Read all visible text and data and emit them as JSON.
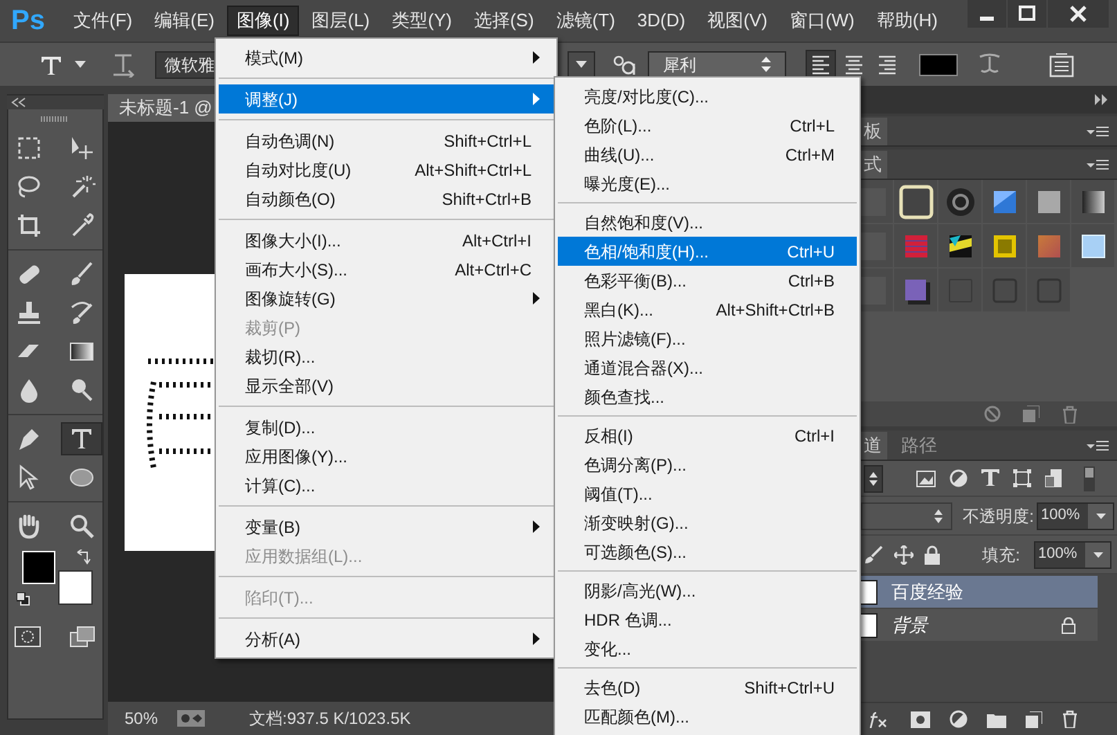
{
  "app_logo": "Ps",
  "menu_bar": [
    {
      "label": "文件(F)",
      "selected": false
    },
    {
      "label": "编辑(E)",
      "selected": false
    },
    {
      "label": "图像(I)",
      "selected": true
    },
    {
      "label": "图层(L)",
      "selected": false
    },
    {
      "label": "类型(Y)",
      "selected": false
    },
    {
      "label": "选择(S)",
      "selected": false
    },
    {
      "label": "滤镜(T)",
      "selected": false
    },
    {
      "label": "3D(D)",
      "selected": false
    },
    {
      "label": "视图(V)",
      "selected": false
    },
    {
      "label": "窗口(W)",
      "selected": false
    },
    {
      "label": "帮助(H)",
      "selected": false
    }
  ],
  "options_bar": {
    "font_family": "微软雅",
    "anti_alias": "犀利",
    "alignment": [
      {
        "selected": true
      },
      {
        "selected": false
      },
      {
        "selected": false
      }
    ]
  },
  "tools": [
    {
      "selected": false
    },
    {
      "selected": false
    },
    {
      "selected": false
    },
    {
      "selected": false
    },
    {
      "selected": false
    },
    {
      "selected": false
    },
    {
      "selected": false
    },
    {
      "selected": false
    },
    {
      "selected": false
    },
    {
      "selected": false
    },
    {
      "selected": false
    },
    {
      "selected": false
    },
    {
      "selected": false
    },
    {
      "selected": false
    },
    {
      "selected": false
    },
    {
      "selected": true
    },
    {
      "selected": false
    },
    {
      "selected": false
    },
    {
      "selected": false
    },
    {
      "selected": false
    }
  ],
  "document_tab": "未标题-1 @",
  "status_bar": {
    "zoom": "50%",
    "doc_size": "文档:937.5 K/1023.5K"
  },
  "image_menu": [
    {
      "kind": "item",
      "label": "模式(M)",
      "submenu": true,
      "selected": false,
      "disabled": false
    },
    {
      "kind": "separator"
    },
    {
      "kind": "item",
      "label": "调整(J)",
      "submenu": true,
      "selected": true,
      "disabled": false
    },
    {
      "kind": "separator"
    },
    {
      "kind": "item",
      "label": "自动色调(N)",
      "shortcut": "Shift+Ctrl+L",
      "selected": false,
      "disabled": false
    },
    {
      "kind": "item",
      "label": "自动对比度(U)",
      "shortcut": "Alt+Shift+Ctrl+L",
      "selected": false,
      "disabled": false
    },
    {
      "kind": "item",
      "label": "自动颜色(O)",
      "shortcut": "Shift+Ctrl+B",
      "selected": false,
      "disabled": false
    },
    {
      "kind": "separator"
    },
    {
      "kind": "item",
      "label": "图像大小(I)...",
      "shortcut": "Alt+Ctrl+I",
      "selected": false,
      "disabled": false
    },
    {
      "kind": "item",
      "label": "画布大小(S)...",
      "shortcut": "Alt+Ctrl+C",
      "selected": false,
      "disabled": false
    },
    {
      "kind": "item",
      "label": "图像旋转(G)",
      "submenu": true,
      "selected": false,
      "disabled": false
    },
    {
      "kind": "item",
      "label": "裁剪(P)",
      "selected": false,
      "disabled": true
    },
    {
      "kind": "item",
      "label": "裁切(R)...",
      "selected": false,
      "disabled": false
    },
    {
      "kind": "item",
      "label": "显示全部(V)",
      "selected": false,
      "disabled": false
    },
    {
      "kind": "separator"
    },
    {
      "kind": "item",
      "label": "复制(D)...",
      "selected": false,
      "disabled": false
    },
    {
      "kind": "item",
      "label": "应用图像(Y)...",
      "selected": false,
      "disabled": false
    },
    {
      "kind": "item",
      "label": "计算(C)...",
      "selected": false,
      "disabled": false
    },
    {
      "kind": "separator"
    },
    {
      "kind": "item",
      "label": "变量(B)",
      "submenu": true,
      "selected": false,
      "disabled": false
    },
    {
      "kind": "item",
      "label": "应用数据组(L)...",
      "selected": false,
      "disabled": true
    },
    {
      "kind": "separator"
    },
    {
      "kind": "item",
      "label": "陷印(T)...",
      "selected": false,
      "disabled": true
    },
    {
      "kind": "separator"
    },
    {
      "kind": "item",
      "label": "分析(A)",
      "submenu": true,
      "selected": false,
      "disabled": false
    }
  ],
  "adjustments_submenu": [
    {
      "kind": "item",
      "label": "亮度/对比度(C)...",
      "selected": false
    },
    {
      "kind": "item",
      "label": "色阶(L)...",
      "shortcut": "Ctrl+L",
      "selected": false
    },
    {
      "kind": "item",
      "label": "曲线(U)...",
      "shortcut": "Ctrl+M",
      "selected": false
    },
    {
      "kind": "item",
      "label": "曝光度(E)...",
      "selected": false
    },
    {
      "kind": "separator"
    },
    {
      "kind": "item",
      "label": "自然饱和度(V)...",
      "selected": false
    },
    {
      "kind": "item",
      "label": "色相/饱和度(H)...",
      "shortcut": "Ctrl+U",
      "selected": true
    },
    {
      "kind": "item",
      "label": "色彩平衡(B)...",
      "shortcut": "Ctrl+B",
      "selected": false
    },
    {
      "kind": "item",
      "label": "黑白(K)...",
      "shortcut": "Alt+Shift+Ctrl+B",
      "selected": false
    },
    {
      "kind": "item",
      "label": "照片滤镜(F)...",
      "selected": false
    },
    {
      "kind": "item",
      "label": "通道混合器(X)...",
      "selected": false
    },
    {
      "kind": "item",
      "label": "颜色查找...",
      "selected": false
    },
    {
      "kind": "separator"
    },
    {
      "kind": "item",
      "label": "反相(I)",
      "shortcut": "Ctrl+I",
      "selected": false
    },
    {
      "kind": "item",
      "label": "色调分离(P)...",
      "selected": false
    },
    {
      "kind": "item",
      "label": "阈值(T)...",
      "selected": false
    },
    {
      "kind": "item",
      "label": "渐变映射(G)...",
      "selected": false
    },
    {
      "kind": "item",
      "label": "可选颜色(S)...",
      "selected": false
    },
    {
      "kind": "separator"
    },
    {
      "kind": "item",
      "label": "阴影/高光(W)...",
      "selected": false
    },
    {
      "kind": "item",
      "label": "HDR 色调...",
      "selected": false
    },
    {
      "kind": "item",
      "label": "变化...",
      "selected": false
    },
    {
      "kind": "separator"
    },
    {
      "kind": "item",
      "label": "去色(D)",
      "shortcut": "Shift+Ctrl+U",
      "selected": false
    },
    {
      "kind": "item",
      "label": "匹配颜色(M)...",
      "selected": false
    }
  ],
  "right_panels": {
    "top_tab": "板",
    "styles_tab": "式",
    "channels_tab": "道",
    "paths_tab": "路径",
    "opacity_label": "不透明度:",
    "opacity_value": "100%",
    "fill_label": "填充:",
    "fill_value": "100%",
    "layers": [
      {
        "name": "百度经验",
        "selected": true,
        "locked": false
      },
      {
        "name": "背景",
        "selected": false,
        "locked": true
      }
    ]
  }
}
